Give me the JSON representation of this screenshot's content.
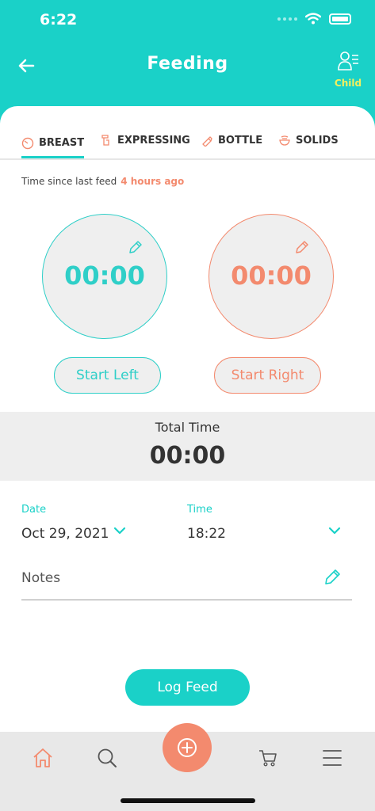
{
  "status_bar": {
    "time": "6:22"
  },
  "header": {
    "title": "Feeding",
    "child_label": "Child"
  },
  "tabs": [
    {
      "label": "BREAST",
      "icon": "breast-icon",
      "active": true
    },
    {
      "label": "EXPRESSING",
      "icon": "pump-icon",
      "active": false
    },
    {
      "label": "BOTTLE",
      "icon": "bottle-icon",
      "active": false
    },
    {
      "label": "SOLIDS",
      "icon": "bowl-icon",
      "active": false
    }
  ],
  "last_feed": {
    "label": "Time since last feed",
    "value": "4 hours ago"
  },
  "timers": {
    "left": {
      "value": "00:00",
      "button": "Start Left"
    },
    "right": {
      "value": "00:00",
      "button": "Start Right"
    }
  },
  "total": {
    "label": "Total Time",
    "value": "00:00"
  },
  "form": {
    "date_label": "Date",
    "date_value": "Oct 29, 2021",
    "time_label": "Time",
    "time_value": "18:22",
    "notes_label": "Notes"
  },
  "log_button": "Log Feed",
  "colors": {
    "primary": "#1ad1c8",
    "accent": "#f38a6e",
    "child": "#f2ef5e"
  },
  "nav": [
    "home-icon",
    "search-icon",
    "add-icon",
    "cart-icon",
    "menu-icon"
  ]
}
